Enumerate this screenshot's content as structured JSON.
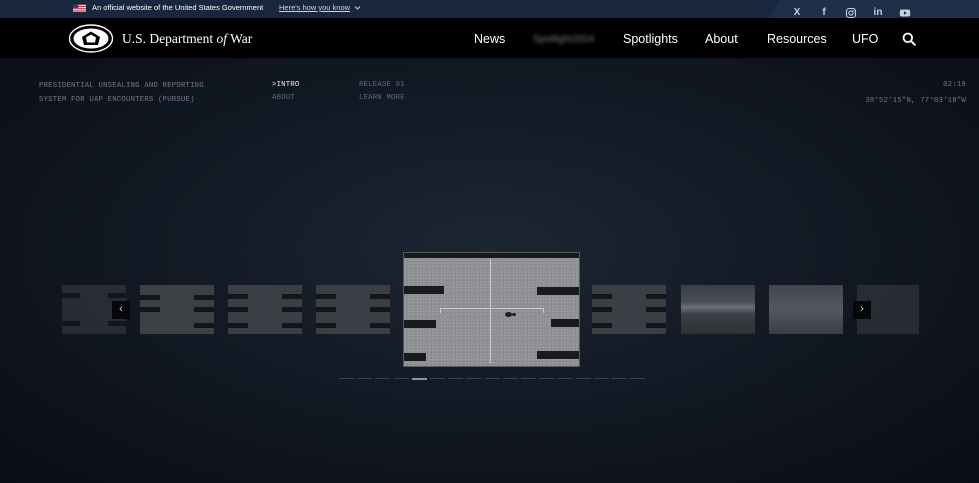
{
  "gov_banner": {
    "official_text": "An official website of the United States Government",
    "how_link": "Here's how you know"
  },
  "social": [
    {
      "name": "x-icon",
      "glyph": "X"
    },
    {
      "name": "facebook-icon",
      "glyph": "f"
    },
    {
      "name": "instagram-icon",
      "glyph": ""
    },
    {
      "name": "linkedin-icon",
      "glyph": "in"
    },
    {
      "name": "youtube-icon",
      "glyph": ""
    }
  ],
  "header": {
    "brand_prefix": "U.S. Department",
    "brand_of": "of",
    "brand_suffix": "War",
    "nav": {
      "news": "News",
      "blurred": "Spotlight2024",
      "spotlights": "Spotlights",
      "about": "About",
      "resources": "Resources",
      "ufo": "UFO"
    }
  },
  "hero": {
    "title_line1": "PRESIDENTIAL UNSEALING AND REPORTING",
    "title_line2": "SYSTEM FOR UAP ENCOUNTERS (PURSUE)",
    "menu_intro": ">INTRO",
    "menu_about": "ABOUT",
    "release": "RELEASE 01",
    "learn_more": "LEARN MORE",
    "clock": "02:19",
    "coords": "38°52'15\"N, 77°03'18\"W",
    "prev_glyph": "‹",
    "next_glyph": "›",
    "carousel_total": 17,
    "carousel_active_index": 4
  },
  "colors": {
    "gov_banner_bg": "#18273d",
    "social_bg": "#1f2f47",
    "navbar_bg": "#000000",
    "hero_bg": "#0b0f17"
  }
}
